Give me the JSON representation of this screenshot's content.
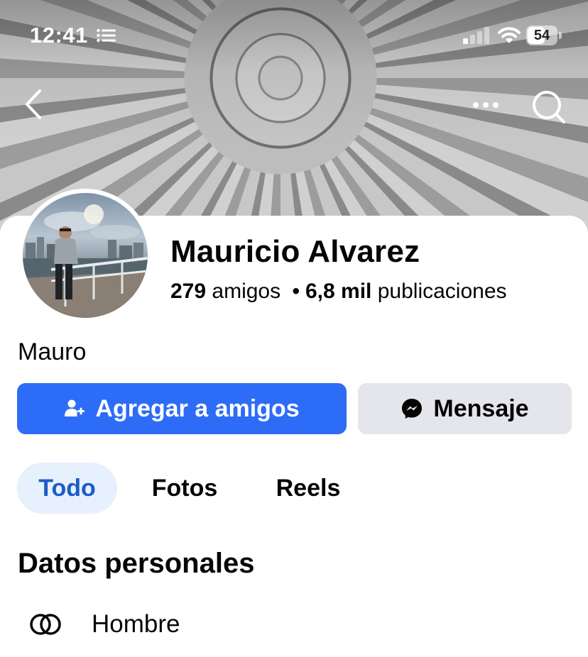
{
  "status_bar": {
    "time": "12:41",
    "battery": "54"
  },
  "profile": {
    "name": "Mauricio Alvarez",
    "friends_count": "279",
    "friends_label": "amigos",
    "separator": "•",
    "posts_count": "6,8 mil",
    "posts_label": "publicaciones",
    "nickname": "Mauro"
  },
  "actions": {
    "add_friend": "Agregar a amigos",
    "message": "Mensaje"
  },
  "tabs": [
    {
      "label": "Todo",
      "active": true
    },
    {
      "label": "Fotos",
      "active": false
    },
    {
      "label": "Reels",
      "active": false
    }
  ],
  "personal_info": {
    "title": "Datos personales",
    "gender": "Hombre"
  },
  "icons": {
    "back": "chevron-left-icon",
    "more": "more-horizontal-icon",
    "search": "search-icon",
    "add_friend": "add-person-icon",
    "message": "messenger-icon",
    "gender": "gender-rings-icon"
  },
  "colors": {
    "primary_button": "#2d6cf6",
    "secondary_button": "#e4e6eb",
    "active_tab_bg": "#e7f0fd",
    "active_tab_text": "#1c5bc9"
  }
}
